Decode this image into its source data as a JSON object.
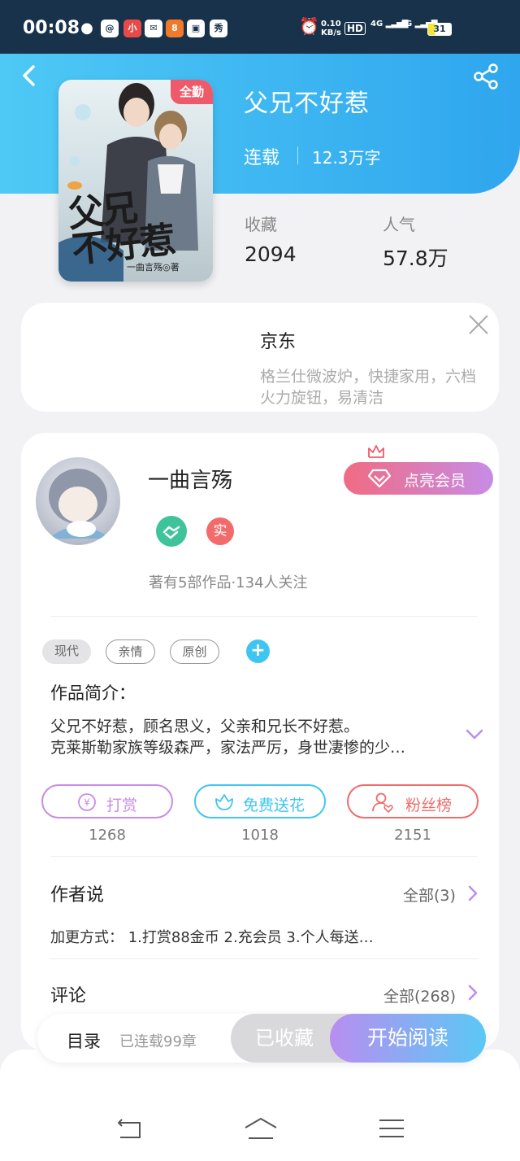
{
  "status_bar": {
    "time": "00:08",
    "net_speed": "0.10",
    "net_unit": "KB/s",
    "hd": "HD",
    "signal1": "4G",
    "signal2": "4G",
    "battery": "31"
  },
  "book": {
    "title": "父兄不好惹",
    "status": "连载",
    "word_count": "12.3万字",
    "cover_badge": "全勤",
    "cover_title_line1": "父兄",
    "cover_title_line2": "不好惹",
    "cover_author": "一曲言殇◎著"
  },
  "stats": {
    "fav_label": "收藏",
    "fav_value": "2094",
    "pop_label": "人气",
    "pop_value": "57.8万"
  },
  "ad": {
    "brand": "京东",
    "desc_line1": "格兰仕微波炉，快捷家用，六档",
    "desc_line2": "火力旋钮，易清洁"
  },
  "author": {
    "name": "一曲言殇",
    "vip_label": "点亮会员",
    "real_badge": "实",
    "works_info": "著有5部作品·134人关注"
  },
  "tags": [
    "现代",
    "亲情",
    "原创"
  ],
  "intro": {
    "heading": "作品简介：",
    "line1": "父兄不好惹，顾名思义，父亲和兄长不好惹。",
    "line2": "克莱斯勒家族等级森严，家法严厉，身世凄惨的少…"
  },
  "actions": {
    "reward_label": "打赏",
    "reward_count": "1268",
    "flower_label": "免费送花",
    "flower_count": "1018",
    "fans_label": "粉丝榜",
    "fans_count": "2151"
  },
  "author_says": {
    "heading": "作者说",
    "all": "全部(3)",
    "text": "加更方式： 1.打赏88金币 2.充会员 3.个人每送…"
  },
  "comments": {
    "heading": "评论",
    "all": "全部(268)"
  },
  "bottom": {
    "catalog": "目录",
    "chapters": "已连载99章",
    "fav_btn": "已收藏",
    "read_btn": "开始阅读"
  },
  "colors": {
    "header_start": "#4ec9f5",
    "header_end": "#2fa6ee",
    "reward": "#c78ce6",
    "flower": "#3fc5f2",
    "fans": "#f06b6b"
  }
}
